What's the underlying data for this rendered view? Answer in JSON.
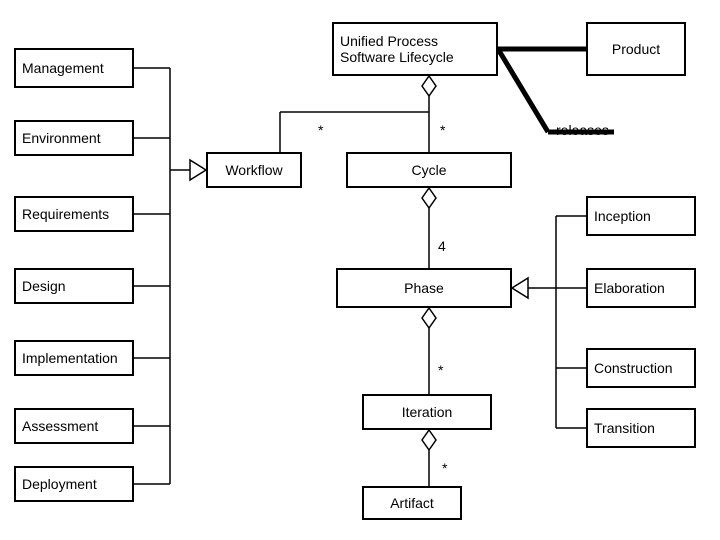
{
  "chart_data": {
    "type": "diagram",
    "title": "Unified Process Software Lifecycle",
    "nodes": [
      {
        "id": "unified",
        "label": "Unified Process Software Lifecycle"
      },
      {
        "id": "product",
        "label": "Product"
      },
      {
        "id": "workflow",
        "label": "Workflow"
      },
      {
        "id": "cycle",
        "label": "Cycle"
      },
      {
        "id": "phase",
        "label": "Phase"
      },
      {
        "id": "iteration",
        "label": "Iteration"
      },
      {
        "id": "artifact",
        "label": "Artifact"
      },
      {
        "id": "management",
        "label": "Management"
      },
      {
        "id": "environment",
        "label": "Environment"
      },
      {
        "id": "requirements",
        "label": "Requirements"
      },
      {
        "id": "design",
        "label": "Design"
      },
      {
        "id": "implementation",
        "label": "Implementation"
      },
      {
        "id": "assessment",
        "label": "Assessment"
      },
      {
        "id": "deployment",
        "label": "Deployment"
      },
      {
        "id": "inception",
        "label": "Inception"
      },
      {
        "id": "elaboration",
        "label": "Elaboration"
      },
      {
        "id": "construction",
        "label": "Construction"
      },
      {
        "id": "transition",
        "label": "Transition"
      }
    ],
    "edges": [
      {
        "from": "unified",
        "to": "workflow",
        "type": "aggregation",
        "multiplicity": "*"
      },
      {
        "from": "unified",
        "to": "cycle",
        "type": "aggregation",
        "multiplicity": "*"
      },
      {
        "from": "unified",
        "to": "product",
        "type": "association",
        "label": "releases"
      },
      {
        "from": "cycle",
        "to": "phase",
        "type": "aggregation",
        "multiplicity": "4"
      },
      {
        "from": "phase",
        "to": "iteration",
        "type": "aggregation",
        "multiplicity": "*"
      },
      {
        "from": "iteration",
        "to": "artifact",
        "type": "aggregation",
        "multiplicity": "*"
      },
      {
        "from": "management",
        "to": "workflow",
        "type": "generalization"
      },
      {
        "from": "environment",
        "to": "workflow",
        "type": "generalization"
      },
      {
        "from": "requirements",
        "to": "workflow",
        "type": "generalization"
      },
      {
        "from": "design",
        "to": "workflow",
        "type": "generalization"
      },
      {
        "from": "implementation",
        "to": "workflow",
        "type": "generalization"
      },
      {
        "from": "assessment",
        "to": "workflow",
        "type": "generalization"
      },
      {
        "from": "deployment",
        "to": "workflow",
        "type": "generalization"
      },
      {
        "from": "inception",
        "to": "phase",
        "type": "generalization"
      },
      {
        "from": "elaboration",
        "to": "phase",
        "type": "generalization"
      },
      {
        "from": "construction",
        "to": "phase",
        "type": "generalization"
      },
      {
        "from": "transition",
        "to": "phase",
        "type": "generalization"
      }
    ]
  },
  "boxes": {
    "unified": "Unified Process Software Lifecycle",
    "product": "Product",
    "workflow": "Workflow",
    "cycle": "Cycle",
    "phase": "Phase",
    "iteration": "Iteration",
    "artifact": "Artifact",
    "management": "Management",
    "environment": "Environment",
    "requirements": "Requirements",
    "design": "Design",
    "implementation": "Implementation",
    "assessment": "Assessment",
    "deployment": "Deployment",
    "inception": "Inception",
    "elaboration": "Elaboration",
    "construction": "Construction",
    "transition": "Transition"
  },
  "labels": {
    "releases": "releases",
    "star1": "*",
    "star2": "*",
    "four": "4",
    "star3": "*",
    "star4": "*"
  }
}
